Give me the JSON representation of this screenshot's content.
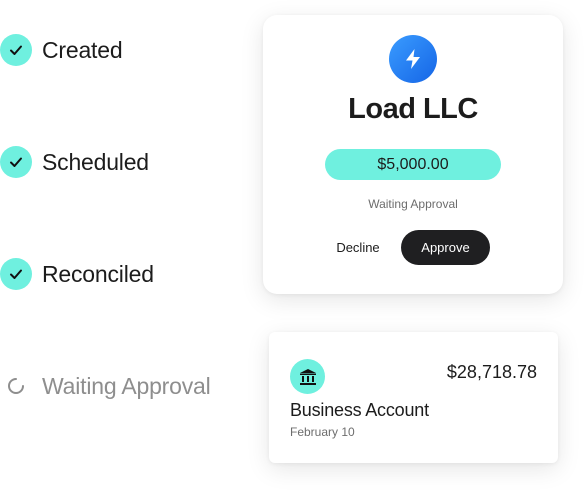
{
  "steps": [
    {
      "label": "Created",
      "state": "done",
      "icon": "check-icon"
    },
    {
      "label": "Scheduled",
      "state": "done",
      "icon": "check-icon"
    },
    {
      "label": "Reconciled",
      "state": "done",
      "icon": "check-icon"
    },
    {
      "label": "Waiting Approval",
      "state": "pending",
      "icon": "spinner-icon"
    }
  ],
  "payment": {
    "icon": "lightning-bolt-icon",
    "company": "Load LLC",
    "amount": "$5,000.00",
    "status": "Waiting Approval",
    "decline_label": "Decline",
    "approve_label": "Approve"
  },
  "account": {
    "icon": "bank-icon",
    "balance": "$28,718.78",
    "name": "Business Account",
    "date": "February 10"
  },
  "colors": {
    "accent": "#6ff0df",
    "primary_button": "#1f1f21",
    "bolt_blue": "#2b82f6",
    "muted_text": "#8e8e8e"
  }
}
